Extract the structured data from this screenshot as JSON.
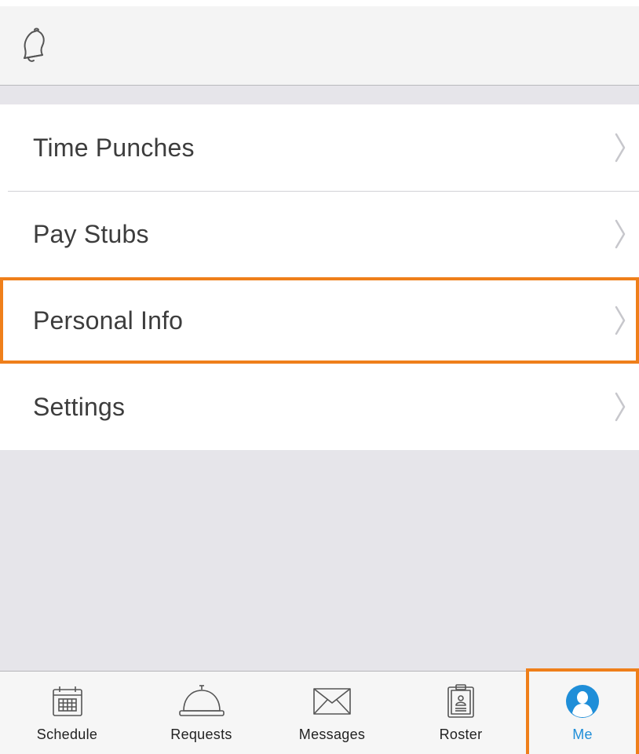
{
  "header": {
    "bell_icon": "bell-icon"
  },
  "menu": {
    "items": [
      {
        "label": "Time Punches",
        "icon": "chevron-right-icon"
      },
      {
        "label": "Pay Stubs",
        "icon": "chevron-right-icon"
      },
      {
        "label": "Personal Info",
        "icon": "chevron-right-icon",
        "highlighted": true
      },
      {
        "label": "Settings",
        "icon": "chevron-right-icon"
      }
    ]
  },
  "tabbar": {
    "tabs": [
      {
        "label": "Schedule",
        "icon": "calendar-icon"
      },
      {
        "label": "Requests",
        "icon": "service-bell-icon"
      },
      {
        "label": "Messages",
        "icon": "envelope-icon"
      },
      {
        "label": "Roster",
        "icon": "clipboard-badge-icon"
      },
      {
        "label": "Me",
        "icon": "person-icon",
        "active": true,
        "highlighted": true
      }
    ]
  },
  "colors": {
    "highlight": "#ef7f1a",
    "active_tab": "#1f8ed8",
    "background": "#e6e5ea",
    "label_text": "#3d3d3d"
  }
}
